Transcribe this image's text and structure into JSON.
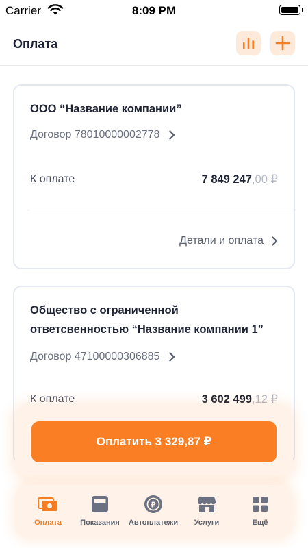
{
  "status_bar": {
    "carrier": "Carrier",
    "time": "8:09 PM"
  },
  "header": {
    "title": "Оплата",
    "icons": [
      "bar-chart-icon",
      "plus-icon"
    ]
  },
  "accounts": [
    {
      "company": "ООО “Название компании”",
      "contract": "Договор 78010000002778",
      "due_label": "К оплате",
      "amount_main": "7 849 247",
      "amount_fraction": ",00 ₽",
      "details_label": "Детали и оплата"
    },
    {
      "company_line1": "Общество с ограниченной",
      "company_line2": "ответсвенностью “Название компании 1”",
      "contract": "Договор 47100000306885",
      "due_label": "К оплате",
      "amount_main": "3 602 499",
      "amount_fraction": ",12 ₽"
    }
  ],
  "pay_button": {
    "label": "Оплатить 3 329,87 ₽"
  },
  "tabs": [
    {
      "label": "Оплата",
      "icon": "payment-icon",
      "active": true
    },
    {
      "label": "Показания",
      "icon": "meter-icon",
      "active": false
    },
    {
      "label": "Автоплатежи",
      "icon": "autopay-icon",
      "active": false
    },
    {
      "label": "Услуги",
      "icon": "store-icon",
      "active": false
    },
    {
      "label": "Ещё",
      "icon": "grid-icon",
      "active": false
    }
  ],
  "colors": {
    "accent": "#fa7e23",
    "accent_light": "#fdeadb",
    "text": "#1d2333",
    "muted": "#6a7080"
  }
}
